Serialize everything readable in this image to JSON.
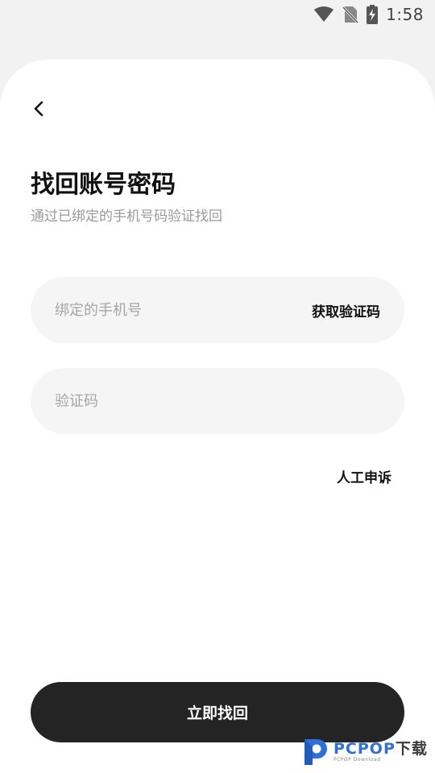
{
  "status_bar": {
    "time": "1:58",
    "icons": [
      "wifi-icon",
      "no-sim-icon",
      "battery-charging-icon"
    ]
  },
  "header": {
    "back_icon": "chevron-left-icon",
    "title": "找回账号密码",
    "subtitle": "通过已绑定的手机号码验证找回"
  },
  "form": {
    "phone_placeholder": "绑定的手机号",
    "phone_value": "",
    "get_code_label": "获取验证码",
    "code_placeholder": "验证码",
    "code_value": ""
  },
  "appeal_label": "人工申诉",
  "submit_label": "立即找回",
  "watermark": {
    "brand": "PCPOP",
    "suffix": "下载",
    "sub": "PCPOP Download"
  },
  "colors": {
    "background": "#f2f2f2",
    "card": "#ffffff",
    "field": "#f5f5f5",
    "button": "#242424",
    "subtitle": "#9a9a9a"
  }
}
